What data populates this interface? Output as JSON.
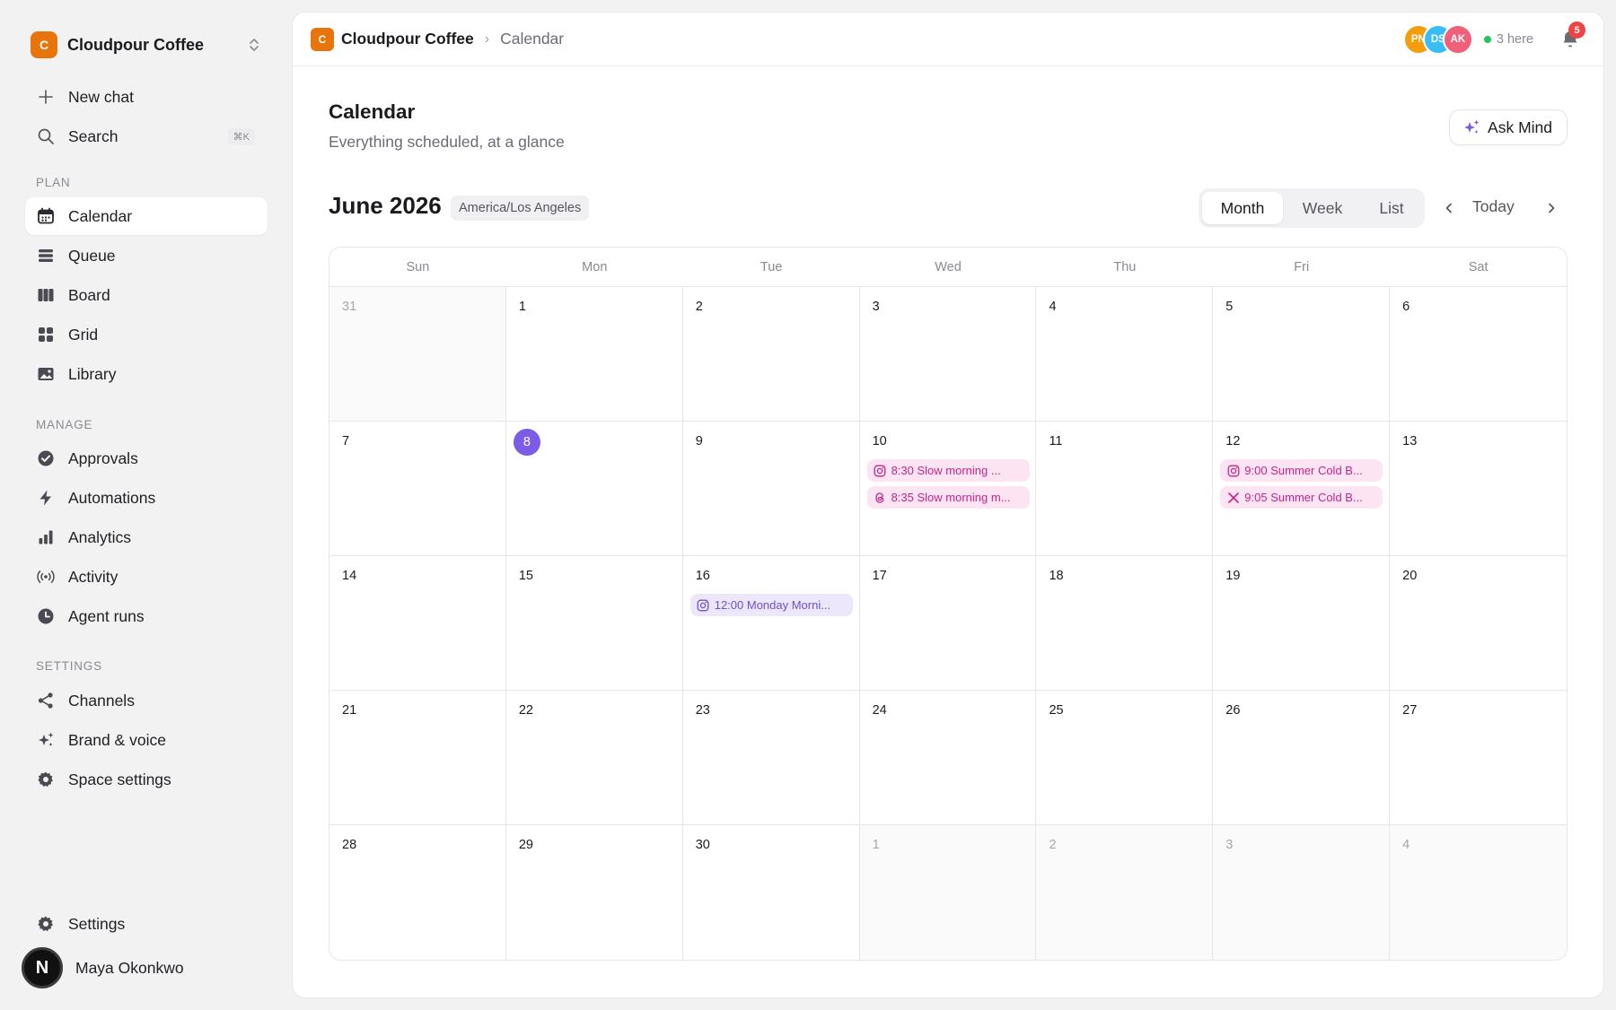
{
  "colors": {
    "accent": "#7c5ce6",
    "brand": "#e8740c",
    "event_pink": "#c0268a",
    "event_purple": "#6d4fd6",
    "badge": "#ef4444",
    "online": "#22c55e"
  },
  "sidebar": {
    "workspace": {
      "logo": "C",
      "name": "Cloudpour Coffee"
    },
    "new_chat": "New chat",
    "search": {
      "label": "Search",
      "shortcut": "⌘K"
    },
    "sections": {
      "plan": "PLAN",
      "manage": "MANAGE",
      "settings": "SETTINGS"
    },
    "plan_items": [
      {
        "label": "Calendar",
        "icon": "calendar-icon",
        "active": true
      },
      {
        "label": "Queue",
        "icon": "queue-icon"
      },
      {
        "label": "Board",
        "icon": "board-icon"
      },
      {
        "label": "Grid",
        "icon": "grid-icon"
      },
      {
        "label": "Library",
        "icon": "library-icon"
      }
    ],
    "manage_items": [
      {
        "label": "Approvals",
        "icon": "check-circle-icon"
      },
      {
        "label": "Automations",
        "icon": "bolt-icon"
      },
      {
        "label": "Analytics",
        "icon": "bar-chart-icon"
      },
      {
        "label": "Activity",
        "icon": "broadcast-icon"
      },
      {
        "label": "Agent runs",
        "icon": "clock-icon"
      }
    ],
    "settings_items": [
      {
        "label": "Channels",
        "icon": "share-icon"
      },
      {
        "label": "Brand & voice",
        "icon": "sparkle-icon"
      },
      {
        "label": "Space settings",
        "icon": "gear-icon"
      }
    ],
    "settings_link": "Settings",
    "user": {
      "initial": "N",
      "name": "Maya Okonkwo"
    }
  },
  "topbar": {
    "logo": "C",
    "workspace": "Cloudpour Coffee",
    "separator": "›",
    "page": "Calendar",
    "presence": [
      {
        "initials": "PN",
        "color": "#f59e0b"
      },
      {
        "initials": "DS",
        "color": "#38bdf8"
      },
      {
        "initials": "AK",
        "color": "#f0607a"
      }
    ],
    "here": "3 here",
    "notifications": "5"
  },
  "header": {
    "title": "Calendar",
    "subtitle": "Everything scheduled, at a glance",
    "ask_button": "Ask Mind"
  },
  "toolbar": {
    "month": "June 2026",
    "timezone": "America/Los Angeles",
    "views": [
      "Month",
      "Week",
      "List"
    ],
    "active_view": "Month",
    "today": "Today"
  },
  "calendar": {
    "weekdays": [
      "Sun",
      "Mon",
      "Tue",
      "Wed",
      "Thu",
      "Fri",
      "Sat"
    ],
    "today": 8,
    "weeks": [
      [
        {
          "d": "31",
          "out": true
        },
        {
          "d": "1"
        },
        {
          "d": "2"
        },
        {
          "d": "3"
        },
        {
          "d": "4"
        },
        {
          "d": "5"
        },
        {
          "d": "6"
        }
      ],
      [
        {
          "d": "7"
        },
        {
          "d": "8",
          "today": true
        },
        {
          "d": "9"
        },
        {
          "d": "10",
          "events": [
            {
              "text": "8:30 Slow morning ...",
              "icon": "instagram-icon",
              "tone": "pink"
            },
            {
              "text": "8:35 Slow morning m...",
              "icon": "threads-icon",
              "tone": "pink"
            }
          ]
        },
        {
          "d": "11"
        },
        {
          "d": "12",
          "events": [
            {
              "text": "9:00 Summer Cold B...",
              "icon": "instagram-icon",
              "tone": "pink"
            },
            {
              "text": "9:05 Summer Cold B...",
              "icon": "x-icon",
              "tone": "pink"
            }
          ]
        },
        {
          "d": "13"
        }
      ],
      [
        {
          "d": "14"
        },
        {
          "d": "15"
        },
        {
          "d": "16",
          "events": [
            {
              "text": "12:00 Monday Morni...",
              "icon": "instagram-icon",
              "tone": "purple"
            }
          ]
        },
        {
          "d": "17"
        },
        {
          "d": "18"
        },
        {
          "d": "19"
        },
        {
          "d": "20"
        }
      ],
      [
        {
          "d": "21"
        },
        {
          "d": "22"
        },
        {
          "d": "23"
        },
        {
          "d": "24"
        },
        {
          "d": "25"
        },
        {
          "d": "26"
        },
        {
          "d": "27"
        }
      ],
      [
        {
          "d": "28"
        },
        {
          "d": "29"
        },
        {
          "d": "30"
        },
        {
          "d": "1",
          "out": true
        },
        {
          "d": "2",
          "out": true
        },
        {
          "d": "3",
          "out": true
        },
        {
          "d": "4",
          "out": true
        }
      ]
    ]
  }
}
